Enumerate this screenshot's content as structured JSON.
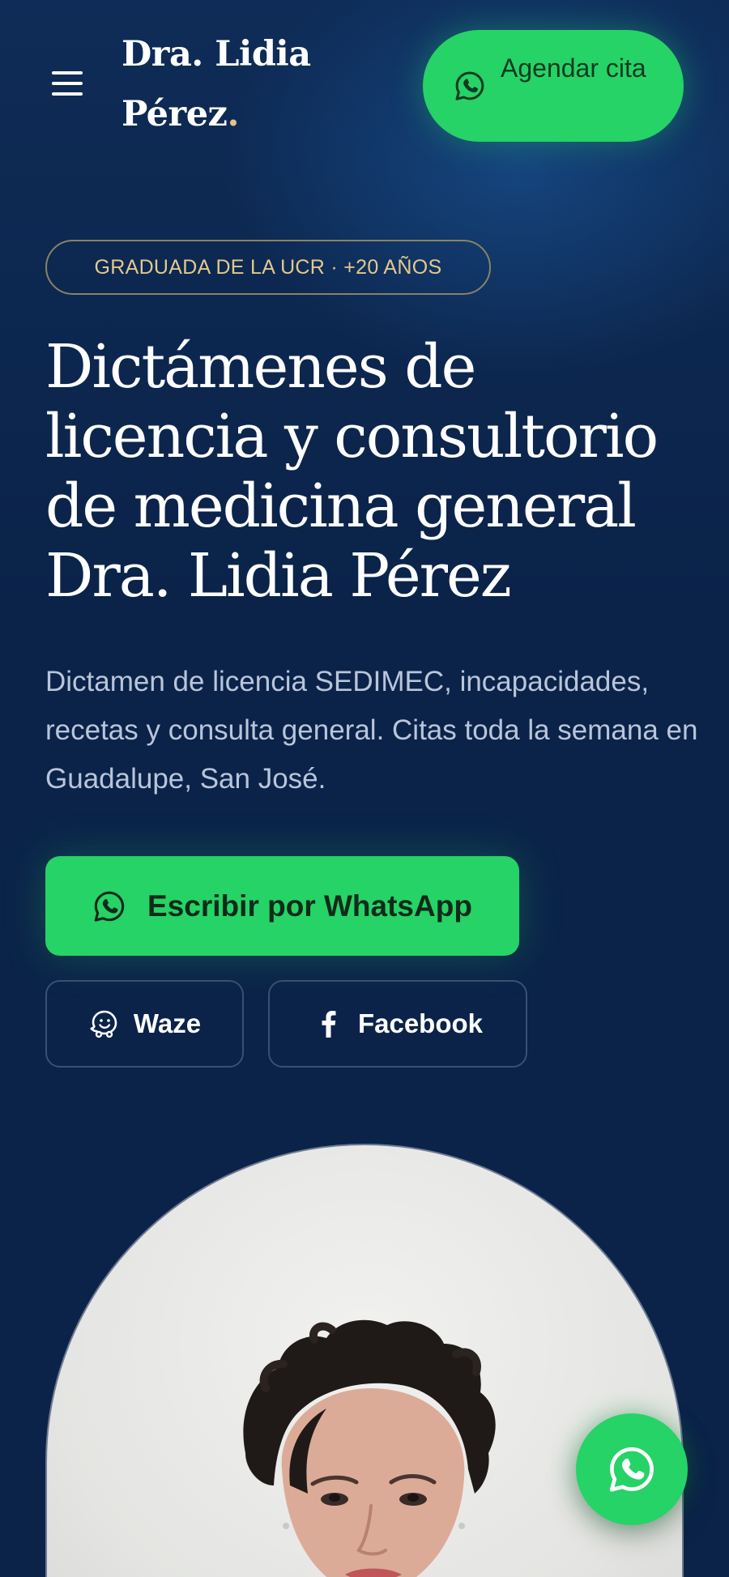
{
  "header": {
    "menu_icon": "hamburger-menu-icon",
    "logo_line1": "Dra. Lidia",
    "logo_line2": "Pérez",
    "logo_dot": ".",
    "cta_label": "Agendar cita",
    "cta_icon": "whatsapp-icon"
  },
  "hero": {
    "badge": "GRADUADA DE LA UCR · +20 AÑOS",
    "title": "Dictámenes de licencia y consultorio de medicina general Dra. Lidia Pérez",
    "lead": "Dictamen de licencia SEDIMEC, incapacidades, recetas y consulta general. Citas toda la semana en Guadalupe, San José.",
    "whatsapp_button": "Escribir por WhatsApp",
    "waze_button": "Waze",
    "facebook_button": "Facebook",
    "waze_icon": "waze-icon",
    "facebook_icon": "facebook-icon"
  },
  "photo": {
    "alt_icon": "portrait-photo"
  },
  "floating_button": {
    "icon": "whatsapp-icon"
  },
  "colors": {
    "background": "#0b2349",
    "accent_green": "#26d366",
    "gold": "#e3c98d",
    "muted_text": "#b9c5da"
  }
}
